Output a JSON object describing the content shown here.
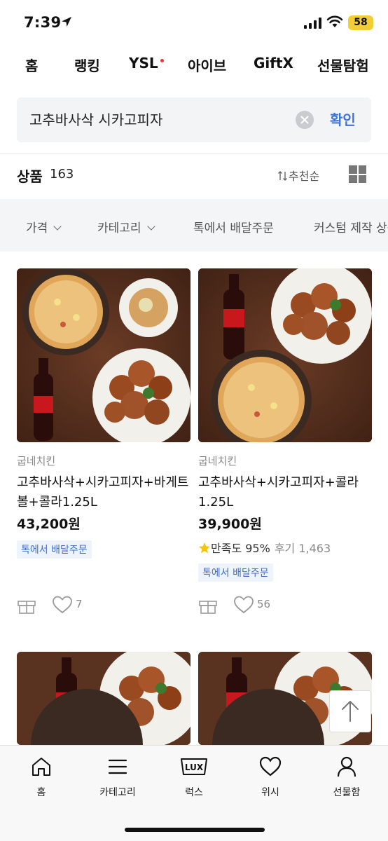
{
  "status_bar": {
    "time": "7:39",
    "battery": "58"
  },
  "top_nav": {
    "items": [
      "홈",
      "랭킹",
      "YSL",
      "아이브",
      "GiftX",
      "선물탐험"
    ]
  },
  "search": {
    "query": "고추바사삭 시카고피자",
    "confirm_label": "확인"
  },
  "products_header": {
    "label": "상품",
    "count": "163",
    "sort_label": "추천순"
  },
  "filters": [
    "가격",
    "카테고리",
    "톡에서 배달주문",
    "커스텀 제작 상품"
  ],
  "products": [
    {
      "brand": "굽네치킨",
      "title": "고추바사삭+시카고피자+바게트볼+콜라1.25L",
      "price": "43,200원",
      "badge": "톡에서 배달주문",
      "likes": "7"
    },
    {
      "brand": "굽네치킨",
      "title": "고추바사삭+시카고피자+콜라1.25L",
      "price": "39,900원",
      "rating_label": "만족도 95%",
      "reviews_label": "후기 1,463",
      "badge": "톡에서 배달주문",
      "likes": "56"
    }
  ],
  "bottom_nav": [
    {
      "label": "홈",
      "icon": "home-icon"
    },
    {
      "label": "카테고리",
      "icon": "menu-icon"
    },
    {
      "label": "럭스",
      "icon": "lux-icon"
    },
    {
      "label": "위시",
      "icon": "heart-icon"
    },
    {
      "label": "선물함",
      "icon": "person-icon"
    }
  ],
  "colors": {
    "accent": "#3d74d6",
    "badge_bg": "#eef3fc",
    "star": "#f4c415",
    "nav_dot": "#f0352a"
  }
}
